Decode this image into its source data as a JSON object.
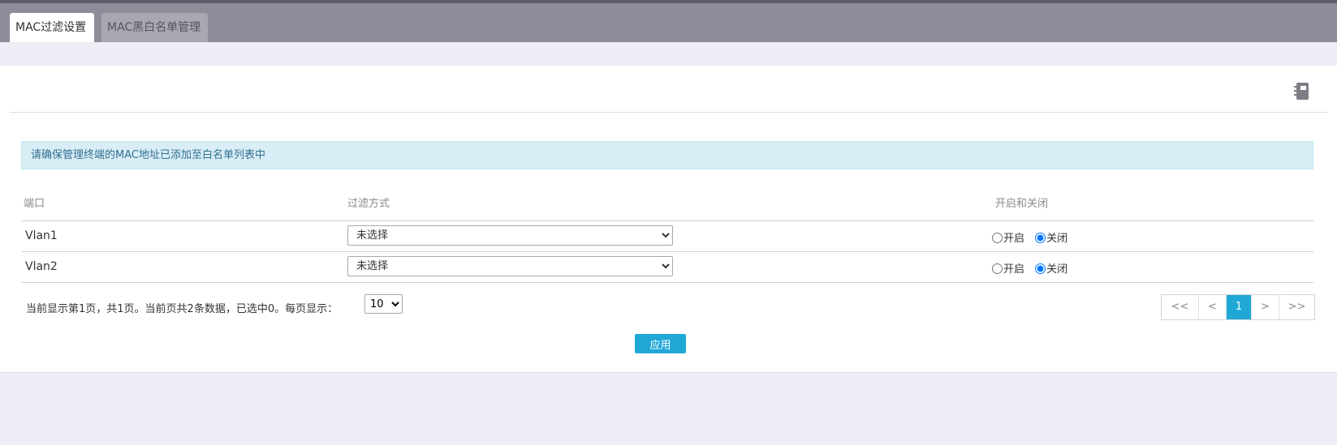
{
  "tabs": [
    {
      "label": "MAC过滤设置",
      "active": true
    },
    {
      "label": "MAC黑白名单管理",
      "active": false
    }
  ],
  "alert": "请确保管理终端的MAC地址已添加至白名单列表中",
  "table": {
    "headers": [
      "端口",
      "过滤方式",
      "开启和关闭"
    ],
    "rows": [
      {
        "port": "Vlan1",
        "filter": "未选择",
        "on_label": "开启",
        "off_label": "关闭",
        "state": "关闭"
      },
      {
        "port": "Vlan2",
        "filter": "未选择",
        "on_label": "开启",
        "off_label": "关闭",
        "state": "关闭"
      }
    ]
  },
  "footer": {
    "info": "当前显示第1页，共1页。当前页共2条数据，已选中0。每页显示：",
    "page_size": "10"
  },
  "pager": {
    "first": "<<",
    "prev": "<",
    "current": "1",
    "next": ">",
    "last": ">>"
  },
  "apply_label": "应用",
  "icons": {
    "doc": "notebook-icon"
  },
  "colors": {
    "accent": "#1fa8d6",
    "tabbar": "#8e8c99",
    "alert_bg": "#d9edf7",
    "alert_text": "#31708f"
  }
}
